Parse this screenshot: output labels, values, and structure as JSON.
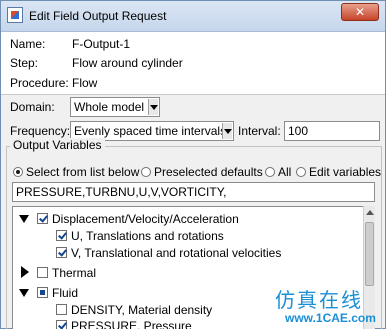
{
  "window": {
    "title": "Edit Field Output Request",
    "close_glyph": "✕"
  },
  "info": {
    "name_label": "Name:",
    "name_value": "F-Output-1",
    "step_label": "Step:",
    "step_value": "Flow around cylinder",
    "procedure_label": "Procedure:",
    "procedure_value": "Flow"
  },
  "domain": {
    "label": "Domain:",
    "value": "Whole model"
  },
  "frequency": {
    "label": "Frequency:",
    "value": "Evenly spaced time intervals",
    "interval_label": "Interval:",
    "interval_value": "100"
  },
  "output_variables": {
    "title": "Output Variables",
    "radio_options": [
      {
        "label": "Select from list below",
        "selected": true
      },
      {
        "label": "Preselected defaults",
        "selected": false
      },
      {
        "label": "All",
        "selected": false
      },
      {
        "label": "Edit variables",
        "selected": false
      }
    ],
    "variables_text": "PRESSURE,TURBNU,U,V,VORTICITY,"
  },
  "tree": {
    "items": [
      {
        "label": "Displacement/Velocity/Acceleration",
        "state": "checked",
        "expanded": true
      },
      {
        "label": "U, Translations and rotations",
        "state": "checked"
      },
      {
        "label": "V, Translational and rotational velocities",
        "state": "checked"
      },
      {
        "label": "Thermal",
        "state": "unchecked",
        "expanded": false
      },
      {
        "label": "Fluid",
        "state": "partial",
        "expanded": true
      },
      {
        "label": "DENSITY, Material density",
        "state": "unchecked"
      },
      {
        "label": "PRESSURE, Pressure",
        "state": "checked"
      }
    ]
  },
  "watermark": {
    "title": "仿真在线",
    "url": "www.1CAE.com"
  },
  "colors": {
    "titlebar": "#c5d6ec",
    "close": "#c7452b",
    "watermark": "#1b8fd6"
  }
}
